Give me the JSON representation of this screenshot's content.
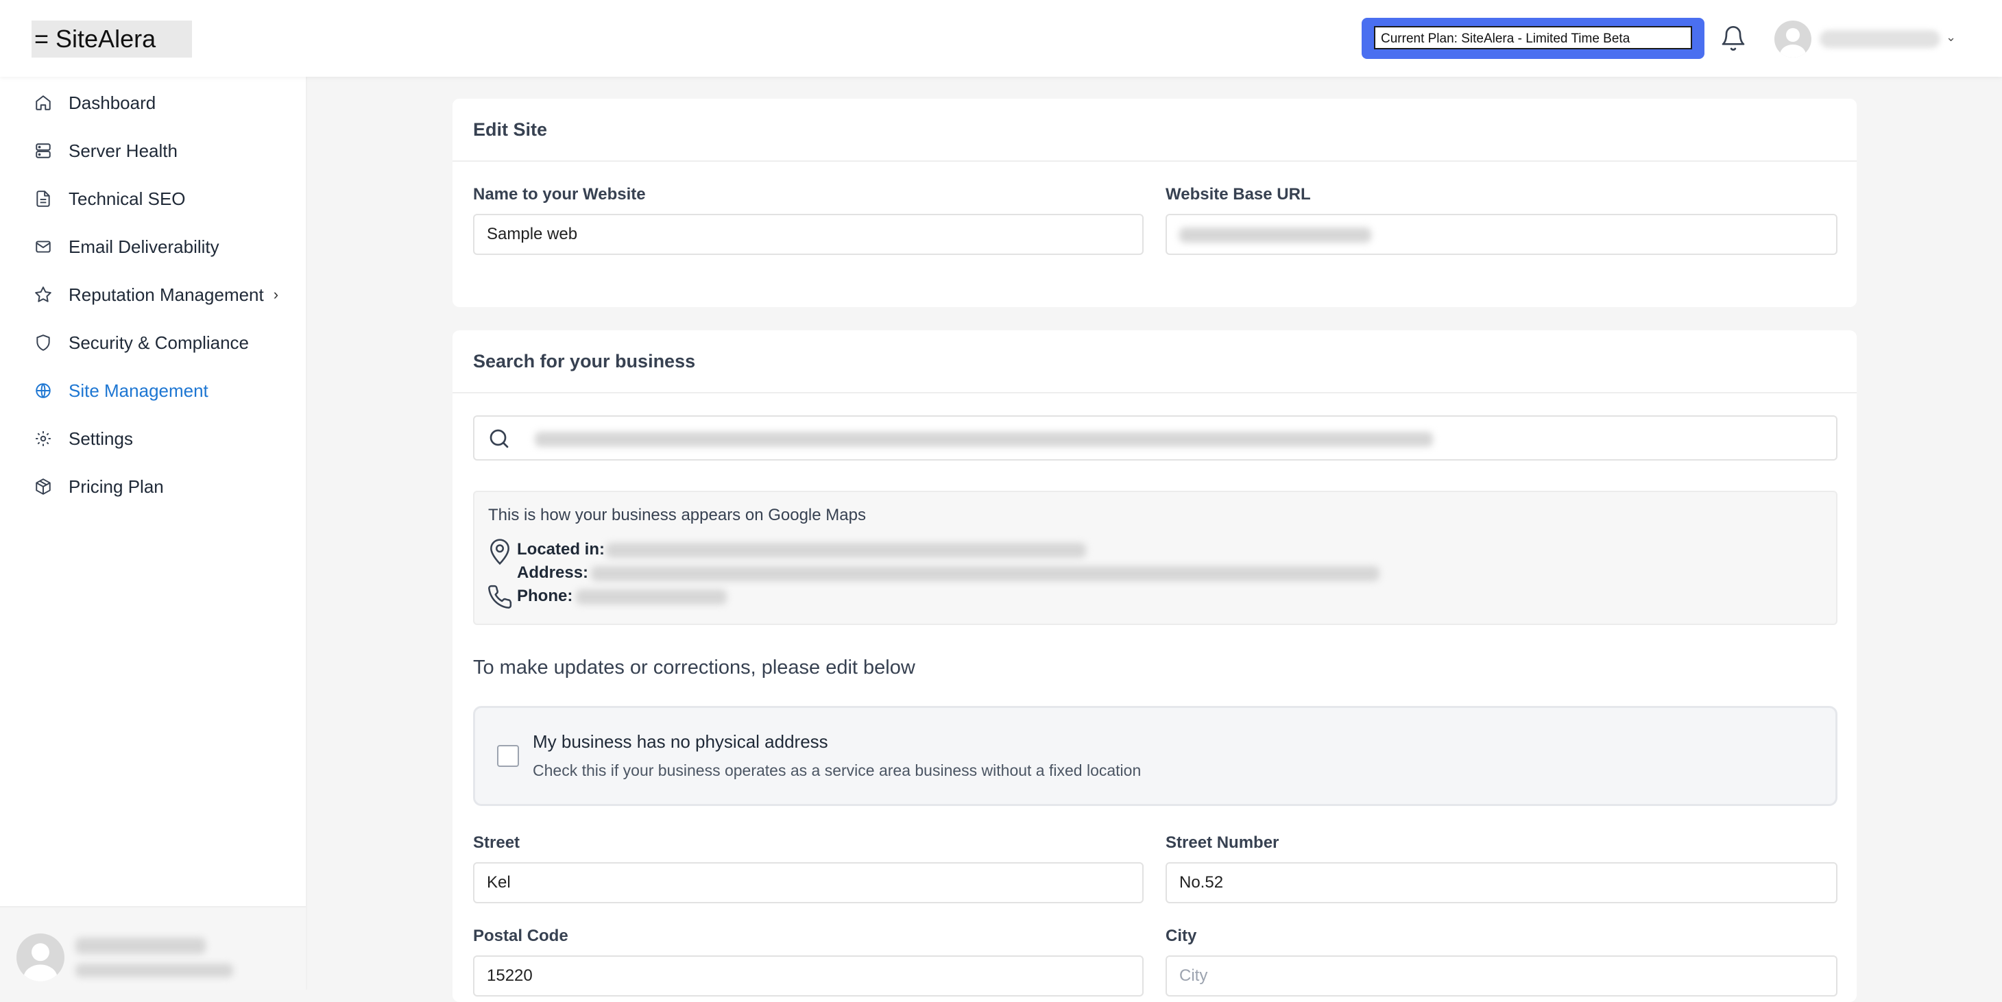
{
  "topbar": {
    "logo": "= SiteAlera",
    "plan_badge": "Current Plan: SiteAlera - Limited Time Beta"
  },
  "sidebar": {
    "items": [
      {
        "label": "Dashboard",
        "icon": "home-icon"
      },
      {
        "label": "Server Health",
        "icon": "server-icon"
      },
      {
        "label": "Technical SEO",
        "icon": "document-icon"
      },
      {
        "label": "Email Deliverability",
        "icon": "mail-icon"
      },
      {
        "label": "Reputation Management",
        "icon": "star-icon",
        "has_submenu": true
      },
      {
        "label": "Security & Compliance",
        "icon": "shield-icon"
      },
      {
        "label": "Site Management",
        "icon": "globe-icon",
        "active": true
      },
      {
        "label": "Settings",
        "icon": "gear-icon"
      },
      {
        "label": "Pricing Plan",
        "icon": "package-icon"
      }
    ]
  },
  "edit_site": {
    "title": "Edit Site",
    "name_label": "Name to your Website",
    "name_value": "Sample web",
    "url_label": "Website Base URL"
  },
  "business": {
    "title": "Search for your business",
    "maps_intro": "This is how your business appears on Google Maps",
    "located_label": "Located in:",
    "address_label": "Address:",
    "phone_label": "Phone:",
    "edit_heading": "To make updates or corrections, please edit below",
    "no_address_title": "My business has no physical address",
    "no_address_desc": "Check this if your business operates as a service area business without a fixed location",
    "street_label": "Street",
    "street_value": "Kel",
    "street_number_label": "Street Number",
    "street_number_value": "No.52",
    "postal_label": "Postal Code",
    "postal_value": "15220",
    "city_label": "City",
    "city_placeholder": "City"
  },
  "colors": {
    "accent": "#1d76d2",
    "plan_badge": "#4a6ff0"
  }
}
